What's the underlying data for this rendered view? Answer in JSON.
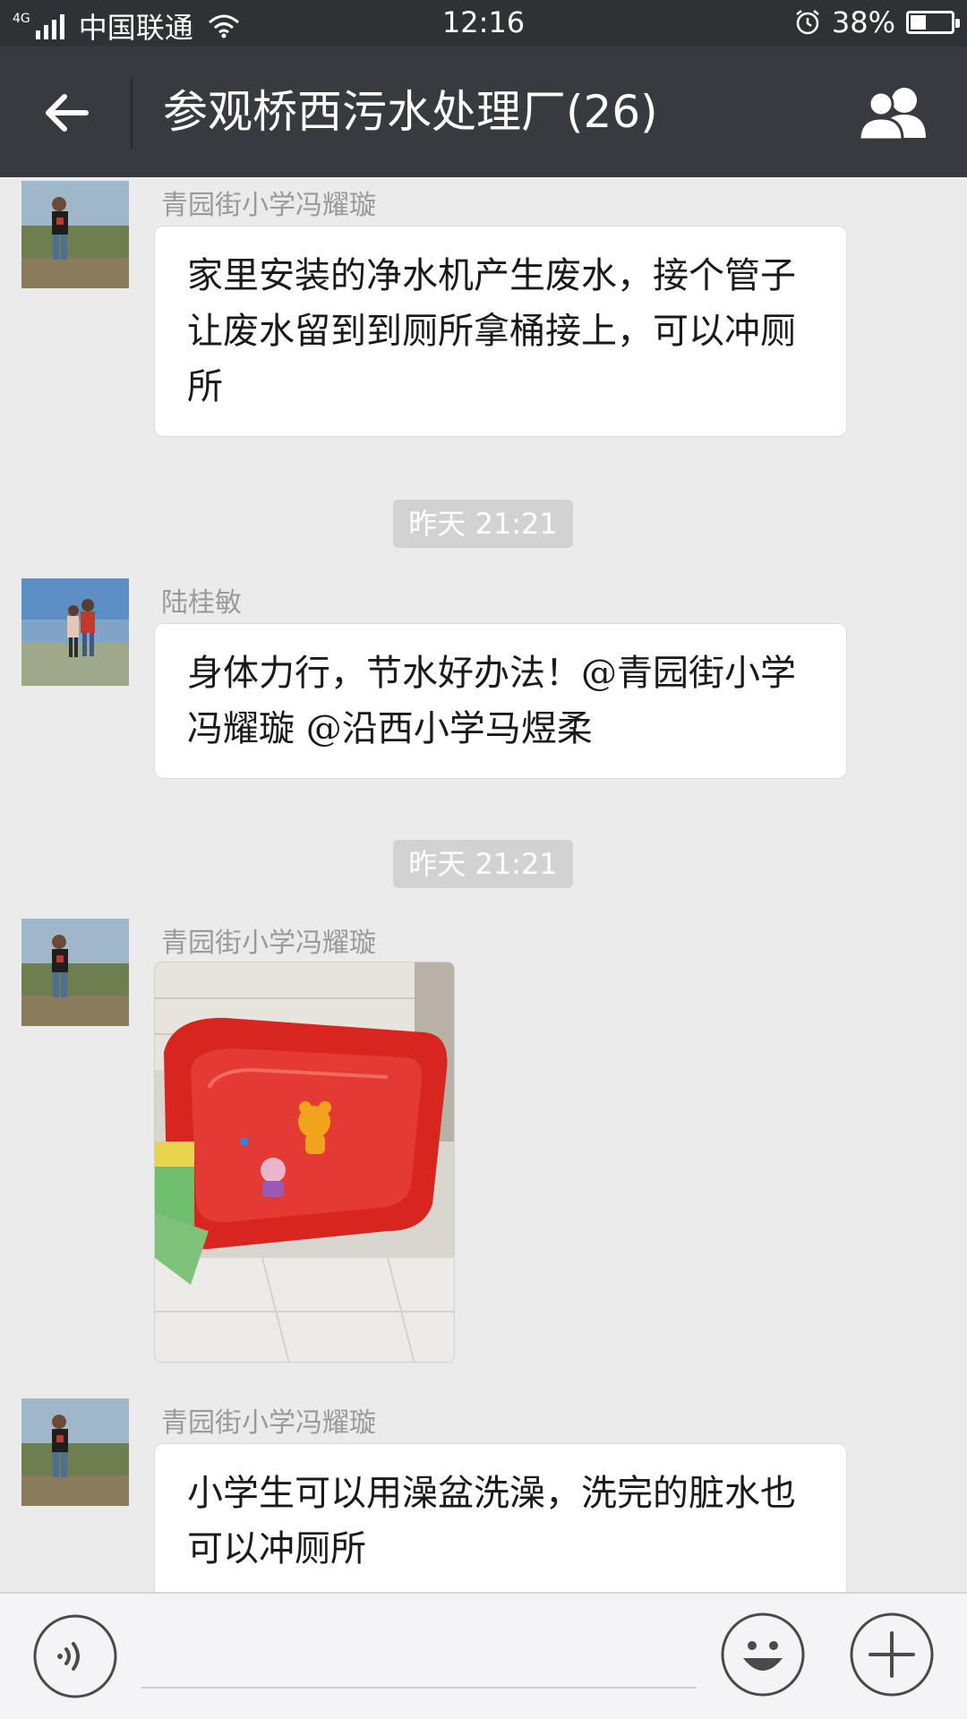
{
  "status_bar": {
    "network": "4G",
    "carrier": "中国联通",
    "time": "12:16",
    "battery": "38%",
    "battery_level": 0.38
  },
  "header": {
    "title": "参观桥西污水处理厂(26)",
    "back_icon": "arrow-left-icon",
    "members_icon": "group-members-icon"
  },
  "messages": [
    {
      "sender": "青园街小学冯耀璇",
      "text": "家里安装的净水机产生废水，接个管子让废水留到到厕所拿桶接上，可以冲厕所"
    },
    {
      "time": "昨天 21:21"
    },
    {
      "sender": "陆桂敏",
      "text": "身体力行，节水好办法！@青园街小学冯耀璇 @沿西小学马煜柔"
    },
    {
      "time": "昨天 21:21"
    },
    {
      "sender": "青园街小学冯耀璇",
      "image": "red-plastic-basin-photo"
    },
    {
      "sender": "青园街小学冯耀璇",
      "text": "小学生可以用澡盆洗澡，洗完的脏水也可以冲厕所"
    }
  ],
  "input_bar": {
    "voice_icon": "voice-icon",
    "emoji_icon": "emoji-icon",
    "plus_icon": "plus-icon"
  },
  "colors": {
    "status_bar_bg": "#2f3234",
    "title_bar_bg": "#393a3f",
    "chat_bg": "#ebebeb",
    "bubble_bg": "#ffffff",
    "timestamp_bg": "#d2d2d2"
  }
}
